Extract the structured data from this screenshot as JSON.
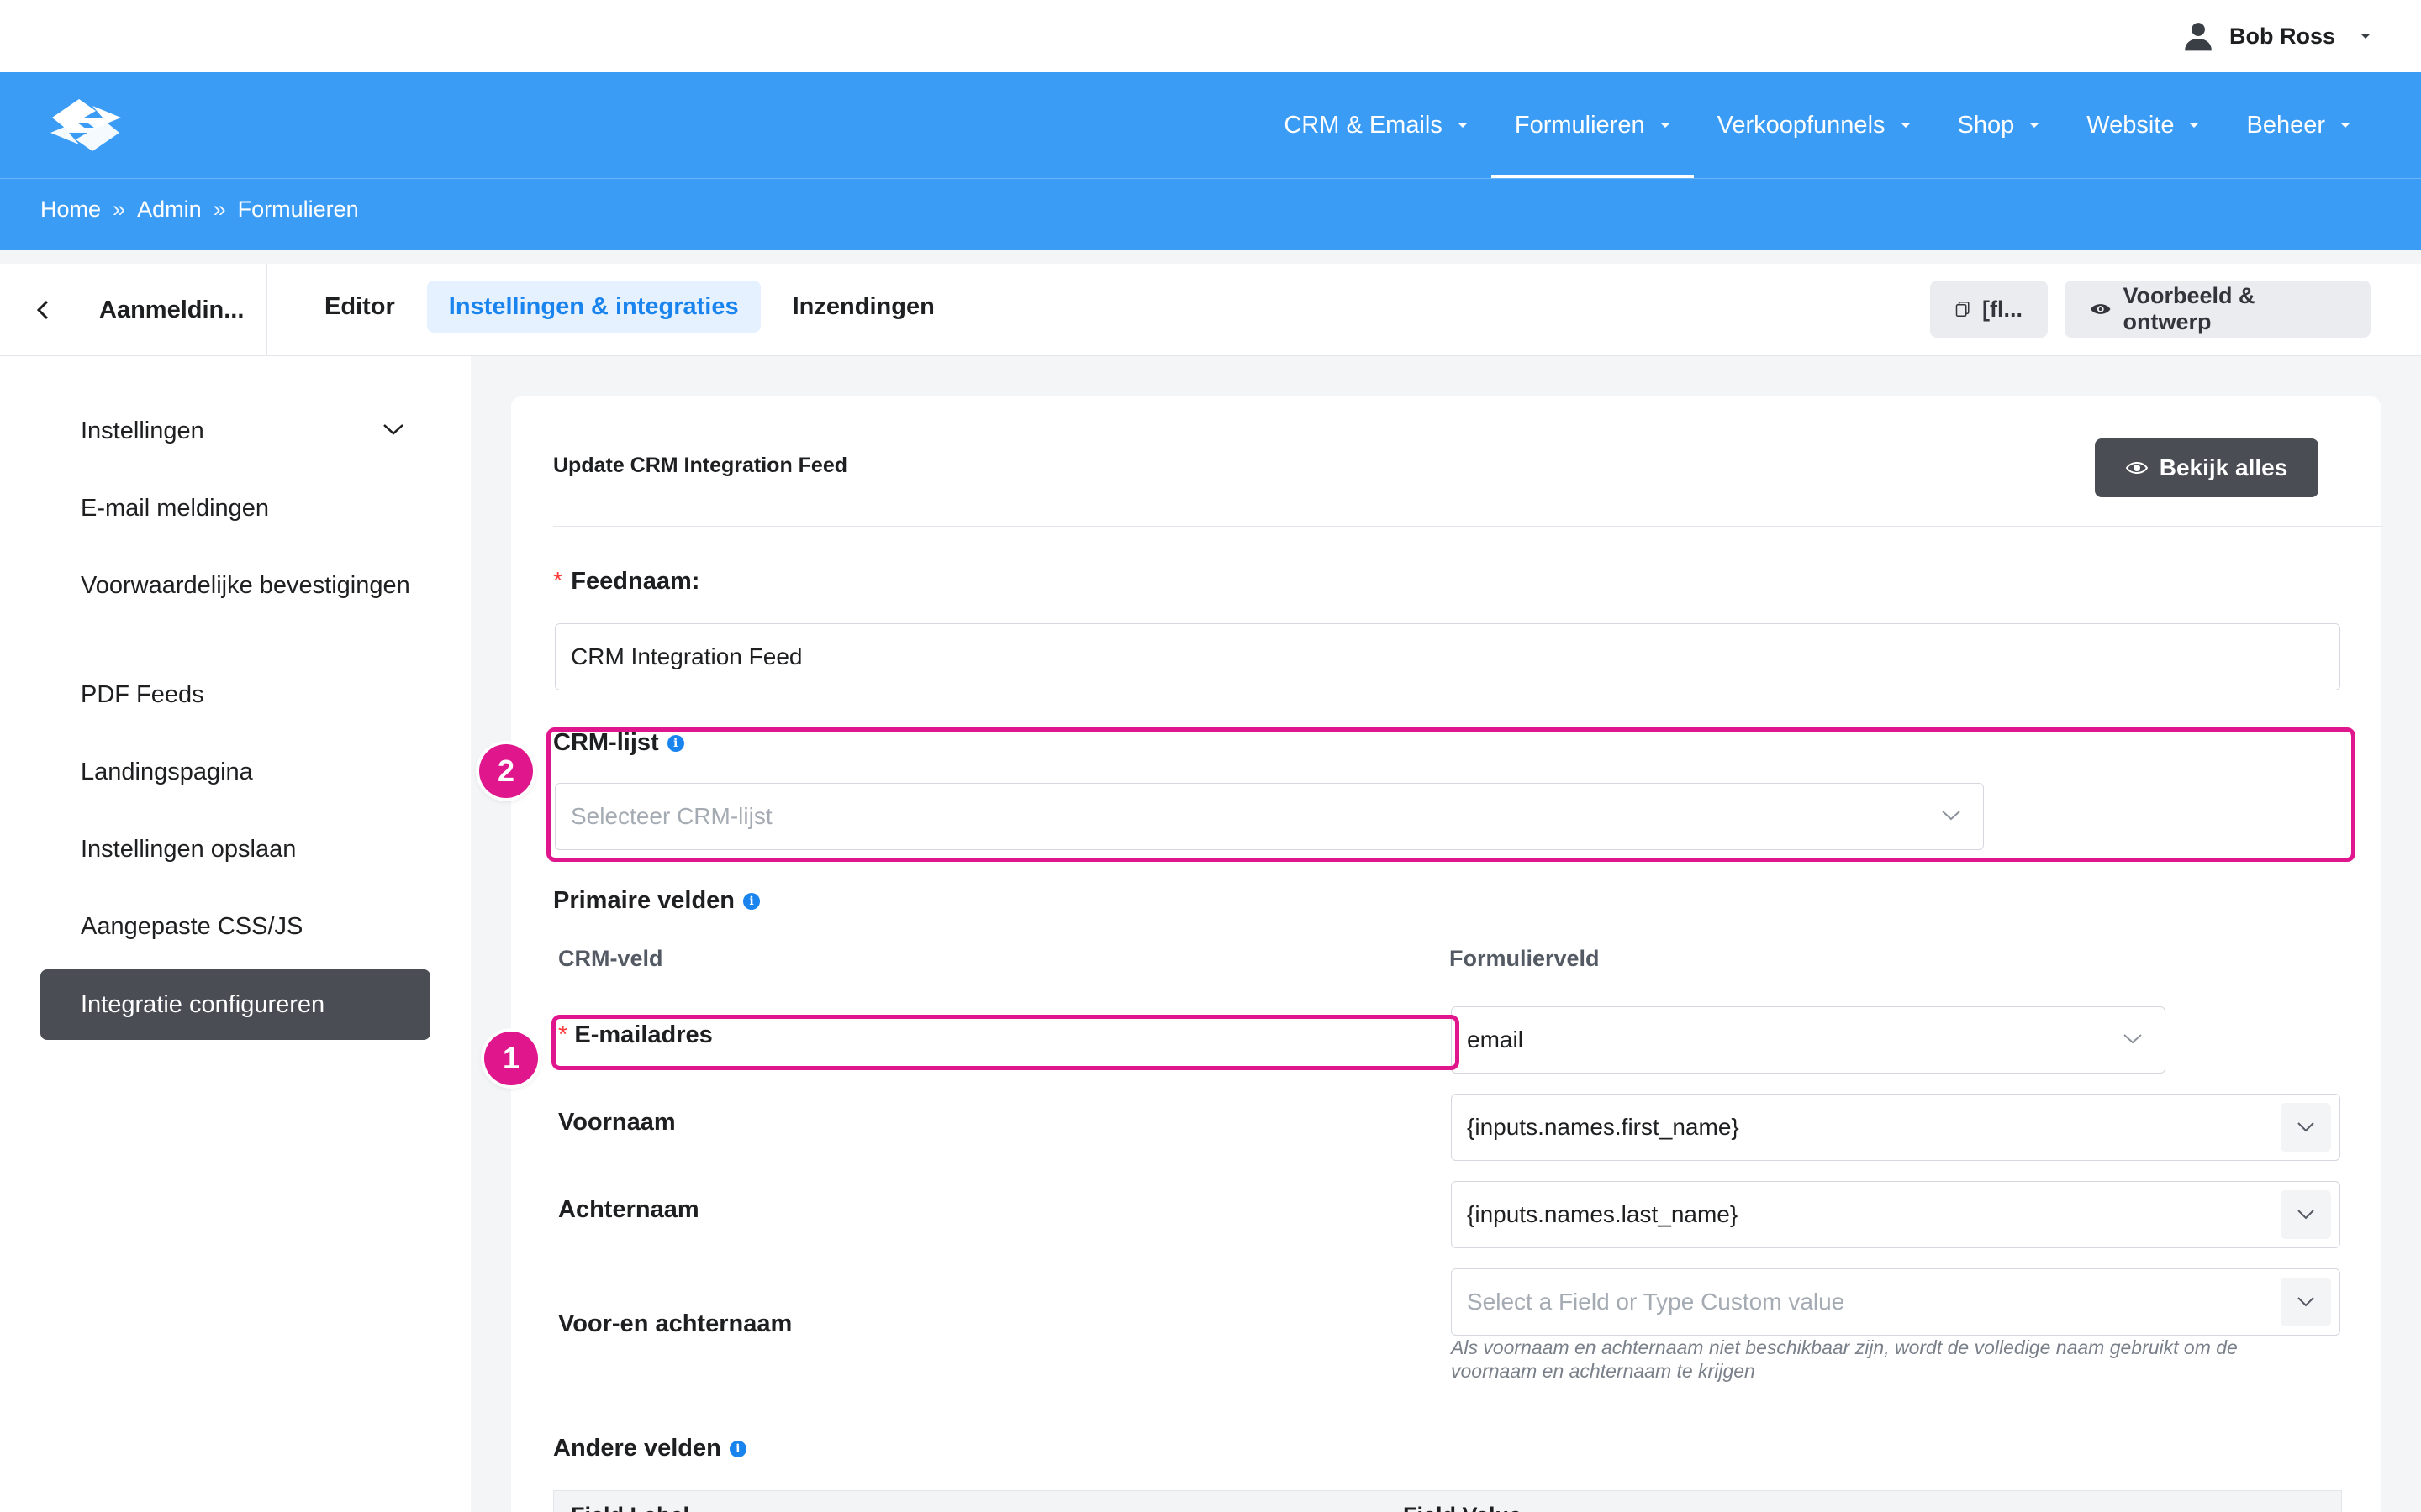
{
  "user": {
    "name": "Bob Ross",
    "icon": "user-icon"
  },
  "nav": {
    "items": [
      {
        "label": "CRM & Emails"
      },
      {
        "label": "Formulieren"
      },
      {
        "label": "Verkoopfunnels"
      },
      {
        "label": "Shop"
      },
      {
        "label": "Website"
      },
      {
        "label": "Beheer"
      }
    ],
    "active_index": 1
  },
  "breadcrumb": {
    "home": "Home",
    "admin": "Admin",
    "current": "Formulieren",
    "separator": "»"
  },
  "toolbar": {
    "form_name": "Aanmeldin...",
    "tabs": [
      {
        "label": "Editor"
      },
      {
        "label": "Instellingen & integraties"
      },
      {
        "label": "Inzendingen"
      }
    ],
    "shortcode_label": "[fl...",
    "preview_label": "Voorbeeld & ontwerp"
  },
  "sidebar": {
    "items": [
      {
        "label": "Instellingen"
      },
      {
        "label": "E-mail meldingen"
      },
      {
        "label": "Voorwaardelijke bevestigingen"
      },
      {
        "label": "PDF Feeds"
      },
      {
        "label": "Landingspagina"
      },
      {
        "label": "Instellingen opslaan"
      },
      {
        "label": "Aangepaste CSS/JS"
      },
      {
        "label": "Integratie configureren"
      }
    ]
  },
  "panel": {
    "title": "Update CRM Integration Feed",
    "view_all_label": "Bekijk alles",
    "feed_name_label": "Feednaam:",
    "feed_name_value": "CRM Integration Feed",
    "crm_list_label": "CRM-lijst",
    "crm_list_placeholder": "Selecteer CRM-lijst",
    "primary_fields_label": "Primaire velden",
    "col_crm_field": "CRM-veld",
    "col_form_field": "Formulierveld",
    "rows": [
      {
        "label": "E-mailadres",
        "value": "email",
        "required": true
      },
      {
        "label": "Voornaam",
        "value": "{inputs.names.first_name}"
      },
      {
        "label": "Achternaam",
        "value": "{inputs.names.last_name}"
      },
      {
        "label": "Voor-en achternaam",
        "placeholder": "Select a Field or Type Custom value",
        "help": "Als voornaam en achternaam niet beschikbaar zijn, wordt de volledige naam gebruikt om de voornaam en achternaam te krijgen"
      }
    ],
    "other_fields_label": "Andere velden",
    "table_headers": [
      "Field Label",
      "Field Value"
    ]
  },
  "markers": {
    "one": "1",
    "two": "2"
  },
  "colors": {
    "brand_blue": "#3b9cf6",
    "highlight_pink": "#e0168c",
    "active_tab_text": "#1a84ee",
    "dark_button": "#4a4e54"
  }
}
